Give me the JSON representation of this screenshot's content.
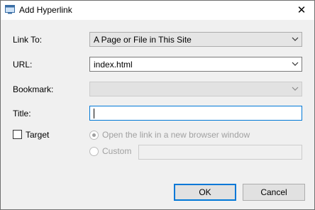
{
  "window": {
    "title": "Add Hyperlink",
    "close_glyph": "✕",
    "icon": "app-window-icon"
  },
  "form": {
    "link_to": {
      "label": "Link To:",
      "value": "A Page or File in This Site"
    },
    "url": {
      "label": "URL:",
      "value": "index.html"
    },
    "bookmark": {
      "label": "Bookmark:",
      "value": ""
    },
    "title": {
      "label": "Title:",
      "value": ""
    },
    "target": {
      "label": "Target",
      "checked": false
    },
    "open_new_window": {
      "label": "Open the link in a new browser window",
      "selected": true,
      "enabled": false
    },
    "custom": {
      "label": "Custom",
      "value": "",
      "selected": false,
      "enabled": false
    }
  },
  "buttons": {
    "ok": "OK",
    "cancel": "Cancel"
  },
  "colors": {
    "focus_border": "#0078d7",
    "dialog_bg": "#f0f0f0",
    "disabled_text": "#a0a0a0"
  }
}
